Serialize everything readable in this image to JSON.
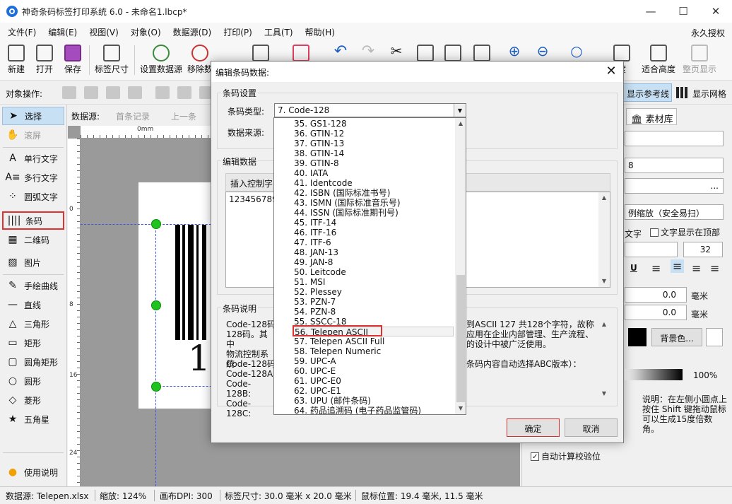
{
  "window": {
    "title": "神奇条码标签打印系统 6.0 - 未命名1.lbcp*"
  },
  "menu": {
    "items": [
      "文件(F)",
      "编辑(E)",
      "视图(V)",
      "对象(O)",
      "数据源(D)",
      "打印(P)",
      "工具(T)",
      "帮助(H)"
    ],
    "license": "永久授权"
  },
  "toolbar": {
    "new": "新建",
    "open": "打开",
    "save": "保存",
    "label_size": "标签尺寸",
    "set_datasource": "设置数据源",
    "remove_datasource": "移除数",
    "width": "度",
    "fit_height": "适合高度",
    "page_display": "整页显示"
  },
  "objrow": {
    "label": "对象操作:",
    "ref_lines": "显示参考线",
    "grid": "显示网格"
  },
  "tools": [
    "选择",
    "滚屏",
    "单行文字",
    "多行文字",
    "圆弧文字",
    "条码",
    "二维码",
    "图片",
    "手绘曲线",
    "直线",
    "三角形",
    "矩形",
    "圆角矩形",
    "圆形",
    "菱形",
    "五角星",
    "使用说明"
  ],
  "dsnav": {
    "label": "数据源:",
    "first": "首条记录",
    "prev": "上一条"
  },
  "canvas": {
    "ruler_0": "0mm",
    "ruler_8": "8",
    "ruler_16": "16",
    "ruler_24": "24",
    "ruler_top_0": "0",
    "digits": "12"
  },
  "right": {
    "assets": "素材库",
    "f8": "8",
    "ellipsis": "...",
    "scale": "例缩放（安全易扫）",
    "text_chk": "文字",
    "text_top": "文字显示在顶部",
    "font_size": "32",
    "off1": "0.0",
    "off2": "0.0",
    "mm": "毫米",
    "bg_color": "背景色...",
    "opacity": "100%",
    "hint": "说明：在左侧小圆点上按住 Shift 键拖动鼠标可以生成15度倍数角。",
    "auto_check": "自动计算校验位"
  },
  "status": {
    "datasource": "数据源: Telepen.xlsx",
    "zoom": "缩放: 124%",
    "dpi": "画布DPI: 300",
    "label_size": "标签尺寸: 30.0 毫米 x 20.0 毫米",
    "mouse": "鼠标位置: 19.4 毫米, 11.5 毫米"
  },
  "dialog": {
    "title": "编辑条码数据:",
    "settings_group": "条码设置",
    "type_label": "条码类型:",
    "type_value": "7.  Code-128",
    "source_label": "数据来源:",
    "edit_group": "编辑数据",
    "insert_ctrl": "插入控制字",
    "data_value": "123456789",
    "desc_group": "条码说明",
    "desc_lines": [
      "Code-128码",
      "128码。其中",
      "物流控制系统"
    ],
    "desc_right": [
      "到ASCII 127 共128个字符，故称",
      "应用在企业内部管理、生产流程、",
      "的设计中被广泛使用。"
    ],
    "desc_lines2": [
      "Code-128码",
      "Code-128A:",
      "Code-128B:",
      "Code-128C:"
    ],
    "desc_right2": "条码内容自动选择ABC版本）：",
    "ok": "确定",
    "cancel": "取消"
  },
  "dropdown": {
    "items": [
      "35.  GS1-128",
      "36.  GTIN-12",
      "37.  GTIN-13",
      "38.  GTIN-14",
      "39.  GTIN-8",
      "40.  IATA",
      "41.  Identcode",
      "42.  ISBN (国际标准书号)",
      "43.  ISMN (国际标准音乐号)",
      "44.  ISSN (国际标准期刊号)",
      "45.  ITF-14",
      "46.  ITF-16",
      "47.  ITF-6",
      "48.  JAN-13",
      "49.  JAN-8",
      "50.  Leitcode",
      "51.  MSI",
      "52.  Plessey",
      "53.  PZN-7",
      "54.  PZN-8",
      "55.  SSCC-18",
      "56.  Telepen ASCII",
      "57.  Telepen ASCII Full",
      "58.  Telepen Numeric",
      "59.  UPC-A",
      "60.  UPC-E",
      "61.  UPC-E0",
      "62.  UPC-E1",
      "63.  UPU (邮件条码)",
      "64.  药品追溯码 (电子药品监管码)"
    ],
    "selected_index": 21
  }
}
